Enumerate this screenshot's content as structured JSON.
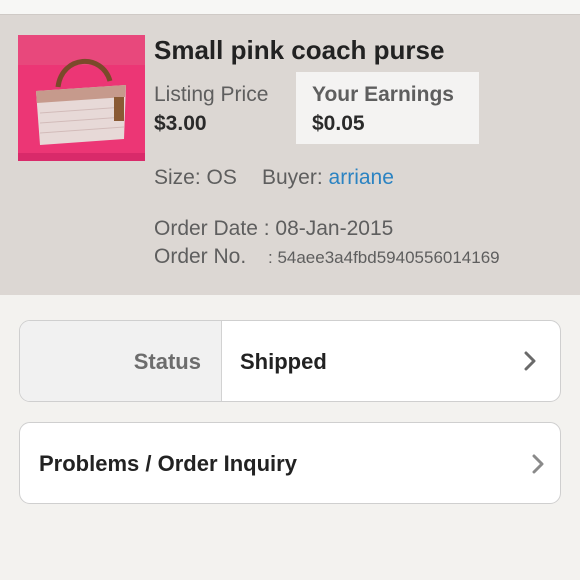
{
  "listing": {
    "title": "Small pink coach purse",
    "listing_price_label": "Listing Price",
    "listing_price": "$3.00",
    "earnings_label": "Your Earnings",
    "earnings": "$0.05",
    "size_label": "Size:",
    "size": "OS",
    "buyer_label": "Buyer:",
    "buyer": "arriane",
    "order_date_label": "Order Date :",
    "order_date": "08-Jan-2015",
    "order_no_label": "Order No.",
    "order_no": ": 54aee3a4fbd5940556014169"
  },
  "status_row": {
    "label": "Status",
    "value": "Shipped",
    "icon": "chevron-right-icon"
  },
  "problems_row": {
    "label": "Problems / Order Inquiry",
    "icon": "chevron-right-icon"
  },
  "colors": {
    "panel_bg": "#dcd7d3",
    "earnings_box_bg": "#f4f3f2",
    "buyer_link": "#2b83c2",
    "page_bg": "#f3f2ef"
  }
}
